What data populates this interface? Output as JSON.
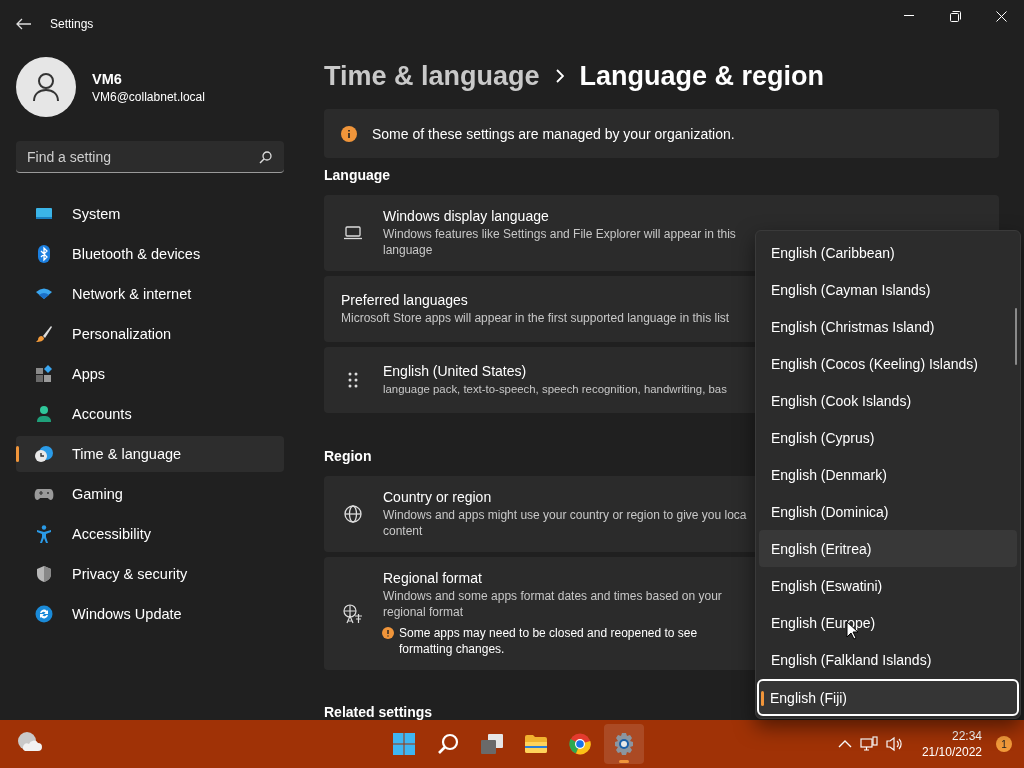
{
  "window": {
    "title": "Settings"
  },
  "profile": {
    "name": "VM6",
    "email": "VM6@collabnet.local"
  },
  "search": {
    "placeholder": "Find a setting"
  },
  "nav": [
    {
      "kind": "system",
      "label": "System",
      "selected": false
    },
    {
      "kind": "bluetooth",
      "label": "Bluetooth & devices",
      "selected": false
    },
    {
      "kind": "network",
      "label": "Network & internet",
      "selected": false
    },
    {
      "kind": "personalization",
      "label": "Personalization",
      "selected": false
    },
    {
      "kind": "apps",
      "label": "Apps",
      "selected": false
    },
    {
      "kind": "accounts",
      "label": "Accounts",
      "selected": false
    },
    {
      "kind": "time",
      "label": "Time & language",
      "selected": true
    },
    {
      "kind": "gaming",
      "label": "Gaming",
      "selected": false
    },
    {
      "kind": "accessibility",
      "label": "Accessibility",
      "selected": false
    },
    {
      "kind": "privacy",
      "label": "Privacy & security",
      "selected": false
    },
    {
      "kind": "update",
      "label": "Windows Update",
      "selected": false
    }
  ],
  "breadcrumb": [
    "Time & language",
    "Language & region"
  ],
  "notice": "Some of these settings are managed by your organization.",
  "sections": [
    {
      "title": "Language",
      "cards": [
        {
          "kind": "laptop",
          "title": "Windows display language",
          "description": "Windows features like Settings and File Explorer will appear in this language"
        },
        {
          "kind": "plain",
          "title": "Preferred languages",
          "description": "Microsoft Store apps will appear in the first supported language in this list"
        },
        {
          "kind": "drag",
          "title": "English (United States)",
          "description": "language pack, text-to-speech, speech recognition, handwriting, bas"
        }
      ]
    },
    {
      "title": "Region",
      "cards": [
        {
          "kind": "globe",
          "title": "Country or region",
          "description": "Windows and apps might use your country or region to give you loca content"
        },
        {
          "kind": "format",
          "title": "Regional format",
          "description": "Windows and some apps format dates and times based on your regional format",
          "warning": "Some apps may need to be closed and reopened to see formatting changes."
        }
      ]
    },
    {
      "title": "Related settings"
    }
  ],
  "dropdown": {
    "options": [
      {
        "label": "English (Caribbean)",
        "hovered": false,
        "selected": false
      },
      {
        "label": "English (Cayman Islands)",
        "hovered": false,
        "selected": false
      },
      {
        "label": "English (Christmas Island)",
        "hovered": false,
        "selected": false
      },
      {
        "label": "English (Cocos (Keeling) Islands)",
        "hovered": false,
        "selected": false
      },
      {
        "label": "English (Cook Islands)",
        "hovered": false,
        "selected": false
      },
      {
        "label": "English (Cyprus)",
        "hovered": false,
        "selected": false
      },
      {
        "label": "English (Denmark)",
        "hovered": false,
        "selected": false
      },
      {
        "label": "English (Dominica)",
        "hovered": false,
        "selected": false
      },
      {
        "label": "English (Eritrea)",
        "hovered": true,
        "selected": false
      },
      {
        "label": "English (Eswatini)",
        "hovered": false,
        "selected": false
      },
      {
        "label": "English (Europe)",
        "hovered": false,
        "selected": false
      },
      {
        "label": "English (Falkland Islands)",
        "hovered": false,
        "selected": false
      },
      {
        "label": "English (Fiji)",
        "hovered": false,
        "selected": true
      }
    ]
  },
  "taskbar": {
    "apps": [
      {
        "kind": "start",
        "active": false
      },
      {
        "kind": "search",
        "active": false
      },
      {
        "kind": "taskview",
        "active": false
      },
      {
        "kind": "files",
        "active": false
      },
      {
        "kind": "browser",
        "active": false
      },
      {
        "kind": "settings",
        "active": true
      }
    ],
    "time": "22:34",
    "date": "21/10/2022",
    "notification_count": "1"
  }
}
